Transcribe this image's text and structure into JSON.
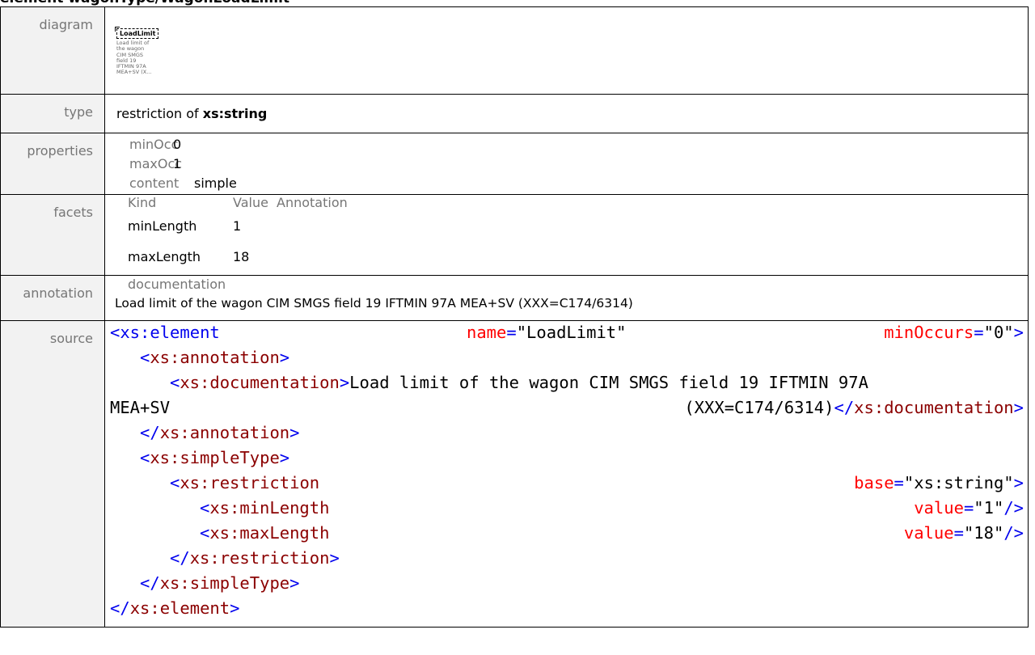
{
  "heading": "element wagonType/WagonLoadLimit",
  "labels": {
    "diagram": "diagram",
    "type": "type",
    "properties": "properties",
    "facets": "facets",
    "annotation": "annotation",
    "source": "source"
  },
  "diagram": {
    "node": "LoadLimit",
    "description_lines": [
      "Load limit of",
      "the wagon",
      "CIM SMGS",
      "field 19",
      "IFTMIN 97A",
      "MEA+SV (X..."
    ]
  },
  "type": {
    "prefix": "restriction of ",
    "base": "xs:string"
  },
  "properties": [
    {
      "key": "minOcc",
      "value": "0"
    },
    {
      "key": "maxOcc",
      "value": "1"
    },
    {
      "key": "content",
      "value": "simple"
    }
  ],
  "facets": {
    "headers": [
      "Kind",
      "Value",
      "Annotation"
    ],
    "rows": [
      {
        "kind": "minLength",
        "value": "1"
      },
      {
        "kind": "maxLength",
        "value": "18"
      }
    ]
  },
  "annotation": {
    "key": "documentation",
    "text": "Load limit of the wagon CIM SMGS field 19 IFTMIN 97A MEA+SV (XXX=C174/6314)"
  },
  "source": {
    "l1": {
      "tag": "xs:element",
      "a1": "name",
      "v1": "\"LoadLimit\"",
      "a2": "minOccurs",
      "v2": "\"0\""
    },
    "l2": "xs:annotation",
    "l3": {
      "tag": "xs:documentation",
      "text": "Load limit of the wagon CIM SMGS field 19 IFTMIN 97A"
    },
    "l4": {
      "text_a": "MEA+SV",
      "text_b": "(XXX=C174/6314)",
      "close": "xs:documentation"
    },
    "l5": "xs:annotation",
    "l6": "xs:simpleType",
    "l7": {
      "tag": "xs:restriction",
      "attr": "base",
      "val": "\"xs:string\""
    },
    "l8": {
      "tag": "xs:minLength",
      "attr": "value",
      "val": "\"1\""
    },
    "l9": {
      "tag": "xs:maxLength",
      "attr": "value",
      "val": "\"18\""
    },
    "l10": "xs:restriction",
    "l11": "xs:simpleType",
    "l12": "xs:element"
  }
}
